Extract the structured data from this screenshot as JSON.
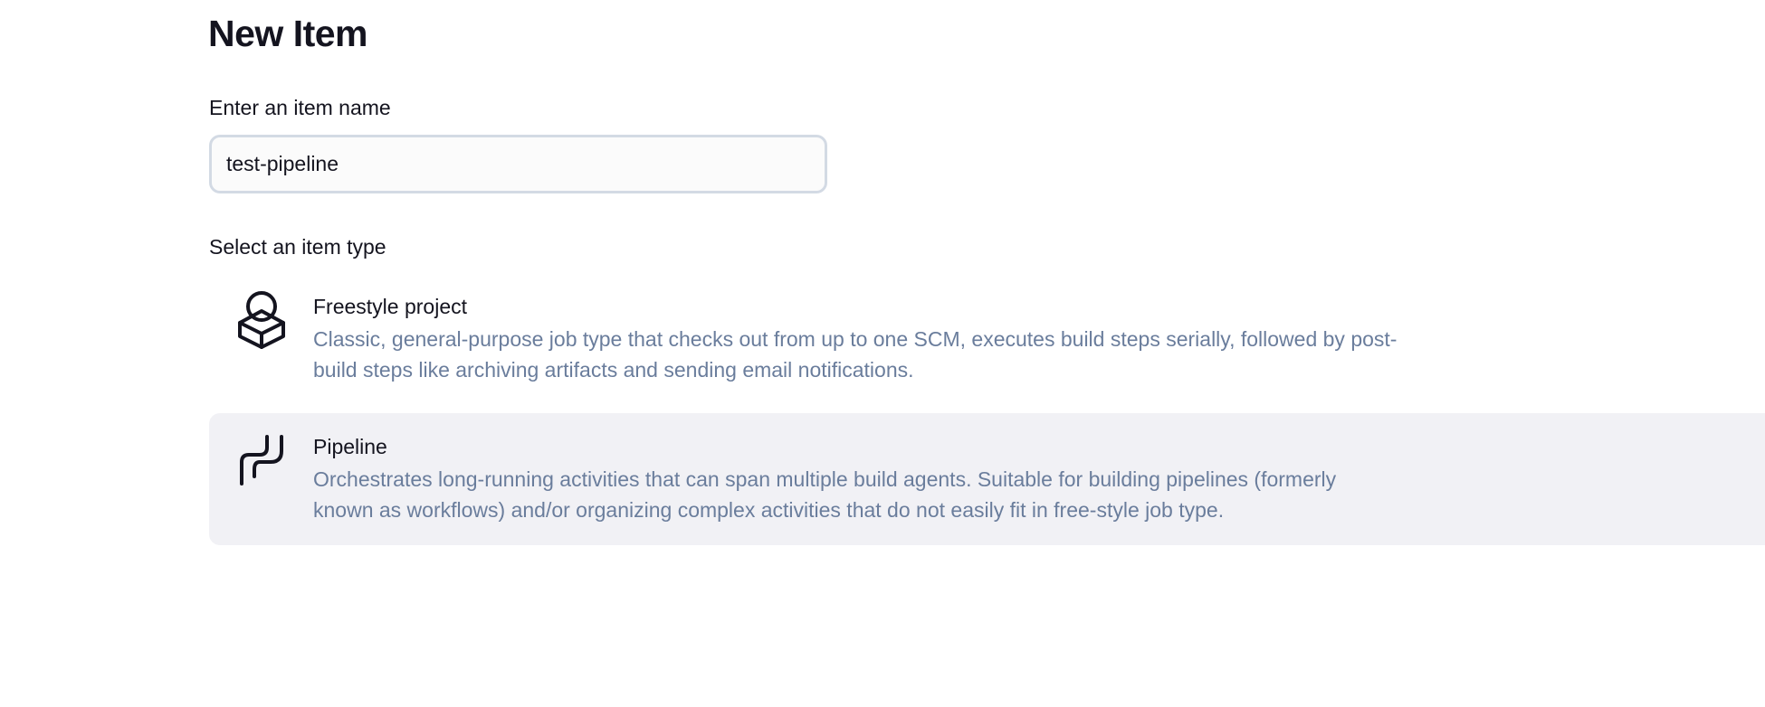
{
  "page": {
    "title": "New Item"
  },
  "form": {
    "name_label": "Enter an item name",
    "name_value": "test-pipeline",
    "type_label": "Select an item type"
  },
  "item_types": [
    {
      "name": "Freestyle project",
      "description": "Classic, general-purpose job type that checks out from up to one SCM, executes build steps serially, followed by post-build steps like archiving artifacts and sending email notifications.",
      "icon": "package-icon",
      "selected": false
    },
    {
      "name": "Pipeline",
      "description": "Orchestrates long-running activities that can span multiple build agents. Suitable for building pipelines (formerly known as workflows) and/or organizing complex activities that do not easily fit in free-style job type.",
      "icon": "pipeline-icon",
      "selected": true
    }
  ],
  "colors": {
    "text": "#14141f",
    "description": "#6a7d9c",
    "input_border": "#d3dae4",
    "selected_bg": "#f1f1f5"
  }
}
